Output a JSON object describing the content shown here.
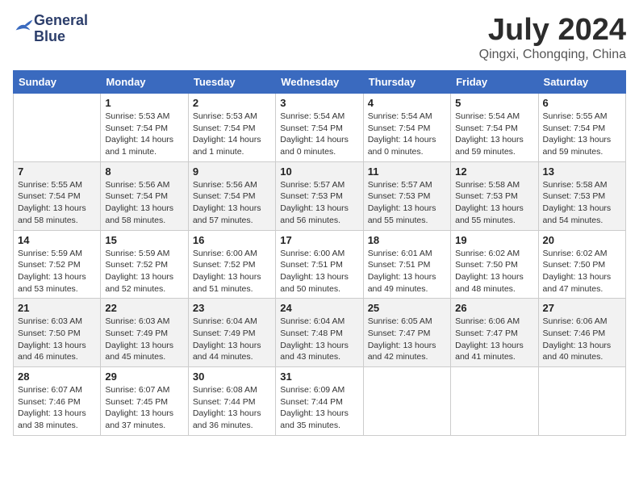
{
  "header": {
    "logo_line1": "General",
    "logo_line2": "Blue",
    "title": "July 2024",
    "subtitle": "Qingxi, Chongqing, China"
  },
  "columns": [
    "Sunday",
    "Monday",
    "Tuesday",
    "Wednesday",
    "Thursday",
    "Friday",
    "Saturday"
  ],
  "weeks": [
    [
      {
        "day": "",
        "info": ""
      },
      {
        "day": "1",
        "info": "Sunrise: 5:53 AM\nSunset: 7:54 PM\nDaylight: 14 hours\nand 1 minute."
      },
      {
        "day": "2",
        "info": "Sunrise: 5:53 AM\nSunset: 7:54 PM\nDaylight: 14 hours\nand 1 minute."
      },
      {
        "day": "3",
        "info": "Sunrise: 5:54 AM\nSunset: 7:54 PM\nDaylight: 14 hours\nand 0 minutes."
      },
      {
        "day": "4",
        "info": "Sunrise: 5:54 AM\nSunset: 7:54 PM\nDaylight: 14 hours\nand 0 minutes."
      },
      {
        "day": "5",
        "info": "Sunrise: 5:54 AM\nSunset: 7:54 PM\nDaylight: 13 hours\nand 59 minutes."
      },
      {
        "day": "6",
        "info": "Sunrise: 5:55 AM\nSunset: 7:54 PM\nDaylight: 13 hours\nand 59 minutes."
      }
    ],
    [
      {
        "day": "7",
        "info": "Sunrise: 5:55 AM\nSunset: 7:54 PM\nDaylight: 13 hours\nand 58 minutes."
      },
      {
        "day": "8",
        "info": "Sunrise: 5:56 AM\nSunset: 7:54 PM\nDaylight: 13 hours\nand 58 minutes."
      },
      {
        "day": "9",
        "info": "Sunrise: 5:56 AM\nSunset: 7:54 PM\nDaylight: 13 hours\nand 57 minutes."
      },
      {
        "day": "10",
        "info": "Sunrise: 5:57 AM\nSunset: 7:53 PM\nDaylight: 13 hours\nand 56 minutes."
      },
      {
        "day": "11",
        "info": "Sunrise: 5:57 AM\nSunset: 7:53 PM\nDaylight: 13 hours\nand 55 minutes."
      },
      {
        "day": "12",
        "info": "Sunrise: 5:58 AM\nSunset: 7:53 PM\nDaylight: 13 hours\nand 55 minutes."
      },
      {
        "day": "13",
        "info": "Sunrise: 5:58 AM\nSunset: 7:53 PM\nDaylight: 13 hours\nand 54 minutes."
      }
    ],
    [
      {
        "day": "14",
        "info": "Sunrise: 5:59 AM\nSunset: 7:52 PM\nDaylight: 13 hours\nand 53 minutes."
      },
      {
        "day": "15",
        "info": "Sunrise: 5:59 AM\nSunset: 7:52 PM\nDaylight: 13 hours\nand 52 minutes."
      },
      {
        "day": "16",
        "info": "Sunrise: 6:00 AM\nSunset: 7:52 PM\nDaylight: 13 hours\nand 51 minutes."
      },
      {
        "day": "17",
        "info": "Sunrise: 6:00 AM\nSunset: 7:51 PM\nDaylight: 13 hours\nand 50 minutes."
      },
      {
        "day": "18",
        "info": "Sunrise: 6:01 AM\nSunset: 7:51 PM\nDaylight: 13 hours\nand 49 minutes."
      },
      {
        "day": "19",
        "info": "Sunrise: 6:02 AM\nSunset: 7:50 PM\nDaylight: 13 hours\nand 48 minutes."
      },
      {
        "day": "20",
        "info": "Sunrise: 6:02 AM\nSunset: 7:50 PM\nDaylight: 13 hours\nand 47 minutes."
      }
    ],
    [
      {
        "day": "21",
        "info": "Sunrise: 6:03 AM\nSunset: 7:50 PM\nDaylight: 13 hours\nand 46 minutes."
      },
      {
        "day": "22",
        "info": "Sunrise: 6:03 AM\nSunset: 7:49 PM\nDaylight: 13 hours\nand 45 minutes."
      },
      {
        "day": "23",
        "info": "Sunrise: 6:04 AM\nSunset: 7:49 PM\nDaylight: 13 hours\nand 44 minutes."
      },
      {
        "day": "24",
        "info": "Sunrise: 6:04 AM\nSunset: 7:48 PM\nDaylight: 13 hours\nand 43 minutes."
      },
      {
        "day": "25",
        "info": "Sunrise: 6:05 AM\nSunset: 7:47 PM\nDaylight: 13 hours\nand 42 minutes."
      },
      {
        "day": "26",
        "info": "Sunrise: 6:06 AM\nSunset: 7:47 PM\nDaylight: 13 hours\nand 41 minutes."
      },
      {
        "day": "27",
        "info": "Sunrise: 6:06 AM\nSunset: 7:46 PM\nDaylight: 13 hours\nand 40 minutes."
      }
    ],
    [
      {
        "day": "28",
        "info": "Sunrise: 6:07 AM\nSunset: 7:46 PM\nDaylight: 13 hours\nand 38 minutes."
      },
      {
        "day": "29",
        "info": "Sunrise: 6:07 AM\nSunset: 7:45 PM\nDaylight: 13 hours\nand 37 minutes."
      },
      {
        "day": "30",
        "info": "Sunrise: 6:08 AM\nSunset: 7:44 PM\nDaylight: 13 hours\nand 36 minutes."
      },
      {
        "day": "31",
        "info": "Sunrise: 6:09 AM\nSunset: 7:44 PM\nDaylight: 13 hours\nand 35 minutes."
      },
      {
        "day": "",
        "info": ""
      },
      {
        "day": "",
        "info": ""
      },
      {
        "day": "",
        "info": ""
      }
    ]
  ]
}
